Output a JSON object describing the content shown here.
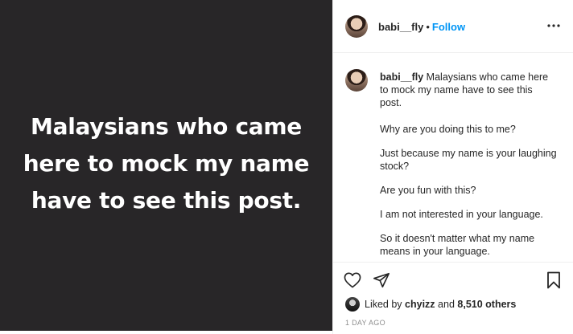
{
  "post": {
    "image_text": "Malaysians who came here to mock my name have to see this post."
  },
  "header": {
    "username": "babi__fly",
    "separator": "•",
    "follow_label": "Follow",
    "more_icon": "more-horizontal-icon"
  },
  "caption": {
    "username": "babi__fly",
    "lines": [
      "Malaysians who came here to mock my name have to see this post.",
      "Why are you doing this to me?",
      "Just because my name is your laughing stock?",
      "Are you fun with this?",
      "I am not interested in your language.",
      "So it doesn't matter what my name means in your language."
    ]
  },
  "actions": {
    "like_icon": "heart-icon",
    "share_icon": "send-icon",
    "save_icon": "bookmark-icon"
  },
  "likes": {
    "prefix": "Liked by",
    "user": "chyizz",
    "connector": "and",
    "count": "8,510 others"
  },
  "timestamp": "1 DAY AGO",
  "colors": {
    "image_bg": "#282628",
    "follow": "#0095f6",
    "text": "#262626",
    "muted": "#8e8e8e"
  }
}
